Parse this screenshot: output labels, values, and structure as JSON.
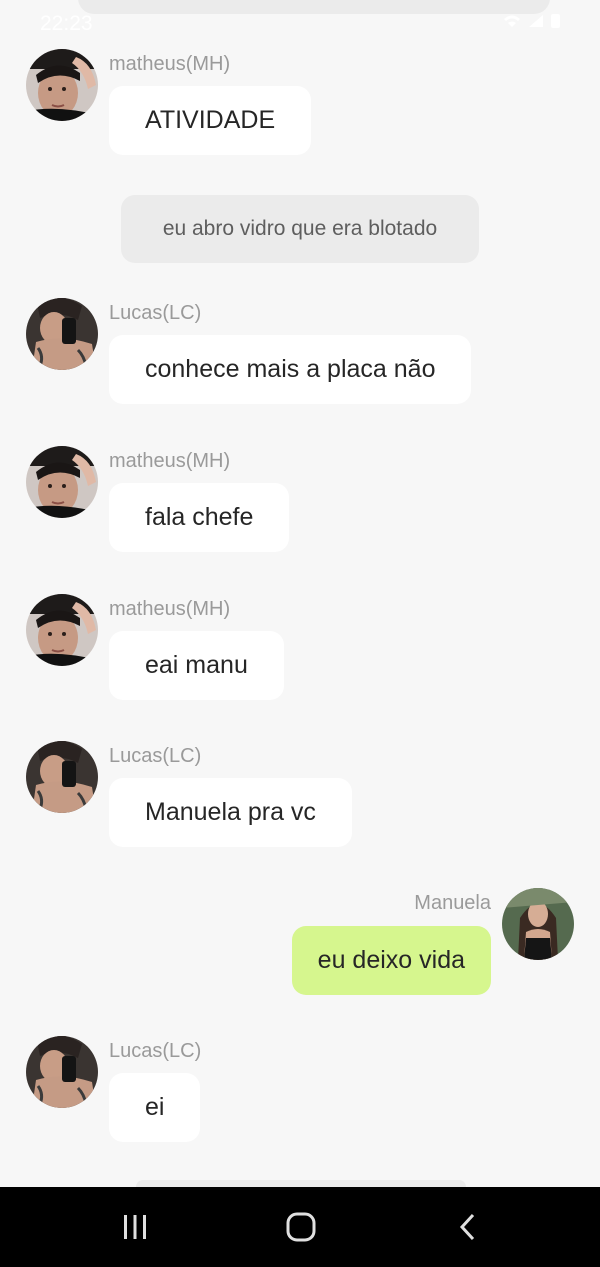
{
  "status_bar": {
    "time": "22:23"
  },
  "system_message": "eu abro vidro que era blotado",
  "messages": [
    {
      "sender": "matheus(MH)",
      "text": "ATIVIDADE",
      "avatar": "matheus-avatar"
    },
    {
      "sender": "Lucas(LC)",
      "text": "conhece mais a placa não",
      "avatar": "lucas-avatar"
    },
    {
      "sender": "matheus(MH)",
      "text": "fala chefe",
      "avatar": "matheus-avatar"
    },
    {
      "sender": "matheus(MH)",
      "text": "eai manu",
      "avatar": "matheus-avatar"
    },
    {
      "sender": "Lucas(LC)",
      "text": "Manuela pra vc",
      "avatar": "lucas-avatar"
    },
    {
      "sender": "Manuela",
      "text": "eu deixo vida",
      "avatar": "manuela-avatar",
      "own": true
    },
    {
      "sender": "Lucas(LC)",
      "text": "ei",
      "avatar": "lucas-avatar"
    }
  ],
  "nav_bar": {
    "recents_icon": "recents-icon",
    "home_icon": "home-icon",
    "back_icon": "back-icon"
  },
  "colors": {
    "background": "#f7f7f7",
    "bubble_incoming": "#ffffff",
    "bubble_outgoing": "#d6f68e",
    "system_pill": "#ebebeb",
    "sender_name": "#9a9a9a",
    "nav_bar": "#000000"
  }
}
